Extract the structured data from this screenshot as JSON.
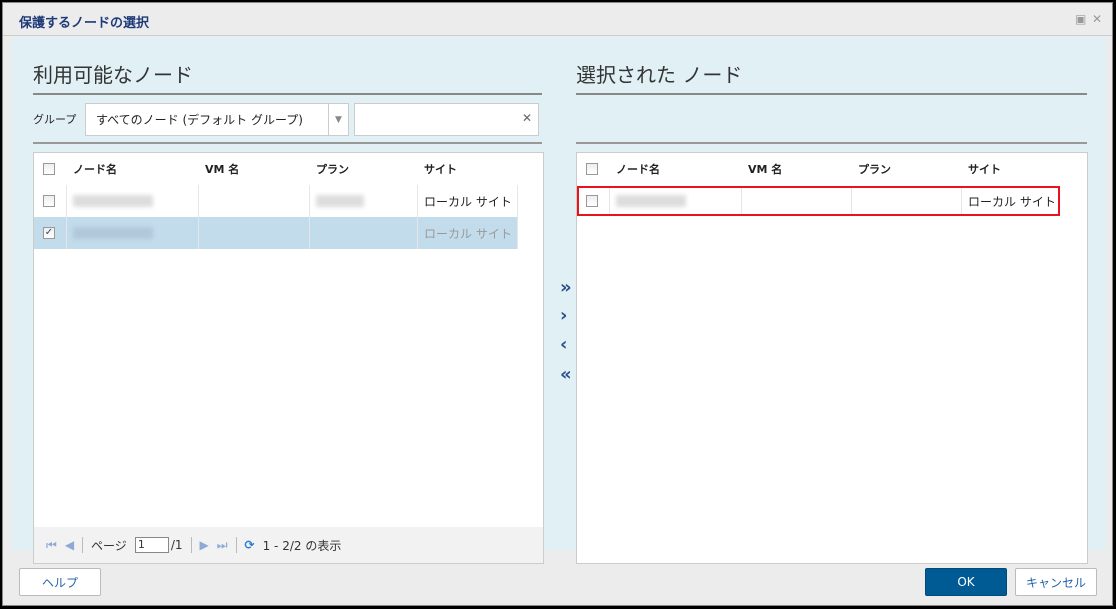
{
  "window": {
    "title": "保護するノードの選択",
    "restore_icon": "restore-icon",
    "close_icon": "close-icon"
  },
  "available": {
    "heading": "利用可能なノード",
    "group_label": "グループ",
    "group_value": "すべてのノード (デフォルト グループ)",
    "search_value": "",
    "columns": [
      "ノード名",
      "VM 名",
      "プラン",
      "サイト"
    ],
    "rows": [
      {
        "node": "",
        "vm": "",
        "plan": "",
        "site": "ローカル サイト",
        "checked": false,
        "selected": false
      },
      {
        "node": "",
        "vm": "",
        "plan": "",
        "site": "ローカル サイト",
        "checked": true,
        "selected": true
      }
    ],
    "pager": {
      "page_label": "ページ",
      "page": "1",
      "total": "/1",
      "summary": "1 - 2/2 の表示"
    }
  },
  "selected": {
    "heading": "選択された ノード",
    "columns": [
      "ノード名",
      "VM 名",
      "プラン",
      "サイト"
    ],
    "rows": [
      {
        "node": "",
        "vm": "",
        "plan": "",
        "site": "ローカル サイト",
        "checked": false,
        "highlight_color": "#e8141b"
      }
    ]
  },
  "transfer": {
    "add_all": "»",
    "add": "›",
    "remove": "‹",
    "remove_all": "«"
  },
  "footer": {
    "help": "ヘルプ",
    "ok": "OK",
    "cancel": "キャンセル"
  },
  "colors": {
    "accent": "#005a94",
    "panel": "#e1f0f5",
    "selected_row": "#c3dcec"
  }
}
